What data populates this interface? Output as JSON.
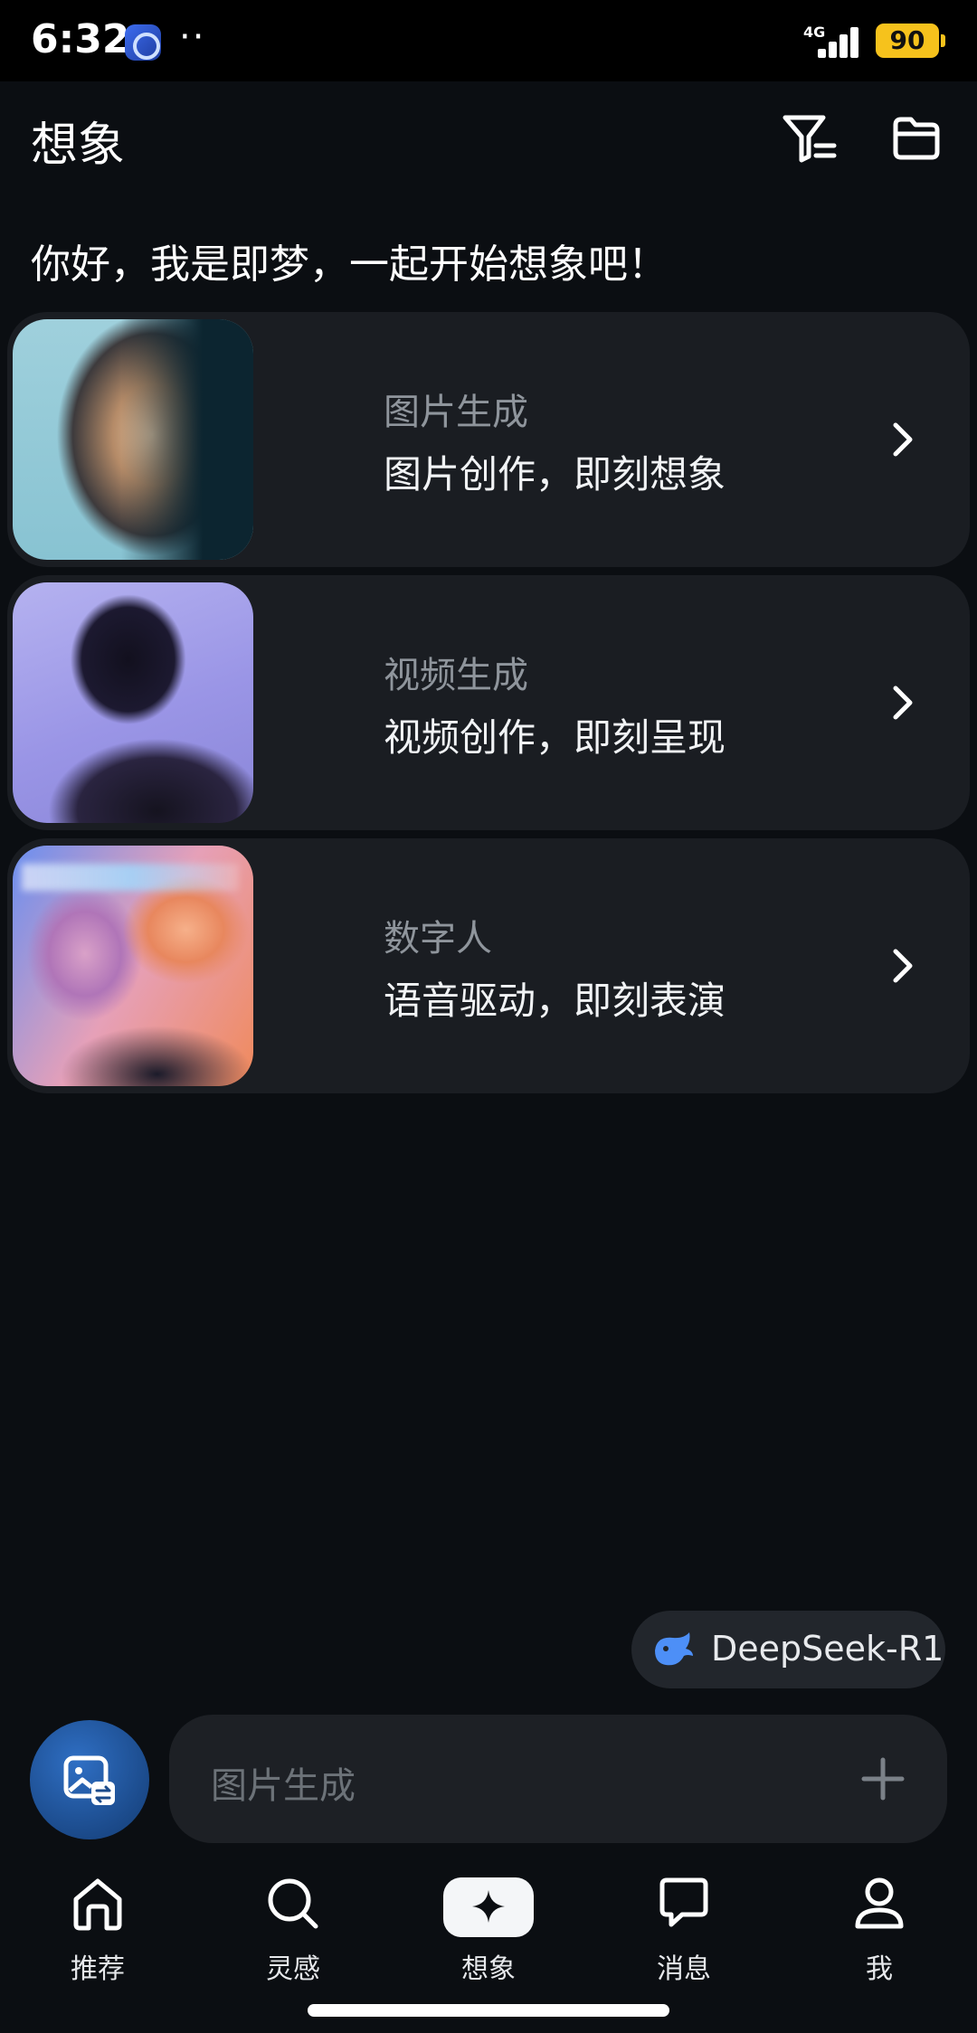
{
  "status_bar": {
    "time": "6:32",
    "dots": "··",
    "network": "4G",
    "battery": "90"
  },
  "header": {
    "title": "想象"
  },
  "greeting": "你好，我是即梦，一起开始想象吧！",
  "cards": [
    {
      "title": "图片生成",
      "subtitle": "图片创作，即刻想象"
    },
    {
      "title": "视频生成",
      "subtitle": "视频创作，即刻呈现"
    },
    {
      "title": "数字人",
      "subtitle": "语音驱动，即刻表演"
    }
  ],
  "model_chip": {
    "label": "DeepSeek-R1"
  },
  "composer": {
    "placeholder": "图片生成"
  },
  "nav": [
    {
      "label": "推荐",
      "icon": "home-icon"
    },
    {
      "label": "灵感",
      "icon": "search-icon"
    },
    {
      "label": "想象",
      "icon": "sparkle-icon",
      "active": true
    },
    {
      "label": "消息",
      "icon": "chat-bubble-icon"
    },
    {
      "label": "我",
      "icon": "person-icon"
    }
  ],
  "colors": {
    "background": "#0b0e12",
    "card": "#1a1d22",
    "accent_blue": "#2f6fc4",
    "battery": "#f6c21c"
  }
}
